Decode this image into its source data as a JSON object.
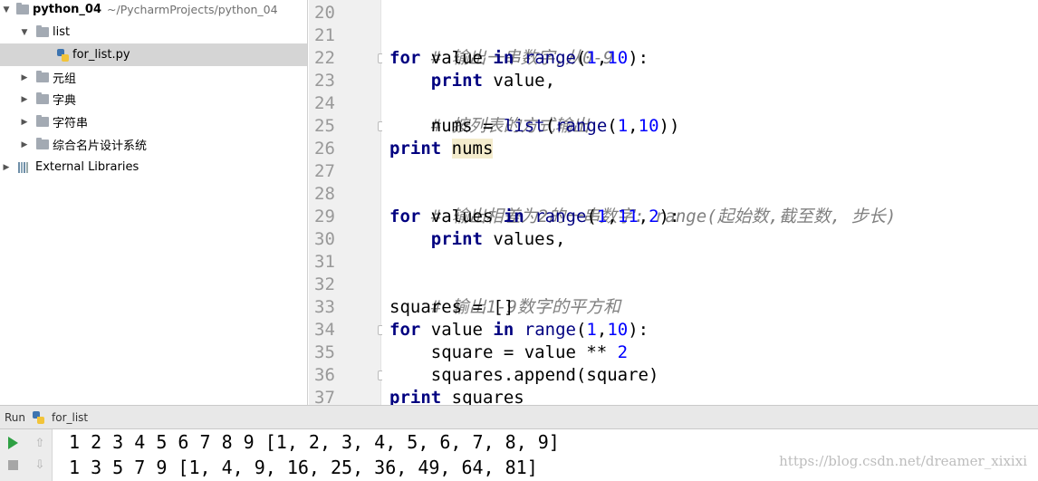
{
  "project_tree": {
    "project_name": "python_04",
    "project_path": "~/PycharmProjects/python_04",
    "items": [
      {
        "label": "list",
        "kind": "folder",
        "expanded": true
      },
      {
        "label": "for_list.py",
        "kind": "python-file",
        "selected": true
      },
      {
        "label": "元组",
        "kind": "folder"
      },
      {
        "label": "字典",
        "kind": "folder"
      },
      {
        "label": "字符串",
        "kind": "folder"
      },
      {
        "label": "综合名片设计系统",
        "kind": "folder"
      },
      {
        "label": "External Libraries",
        "kind": "library"
      }
    ]
  },
  "editor": {
    "line_numbers": [
      "20",
      "21",
      "22",
      "23",
      "24",
      "25",
      "26",
      "27",
      "28",
      "29",
      "30",
      "31",
      "32",
      "33",
      "34",
      "35",
      "36",
      "37"
    ],
    "lines": {
      "l21": {
        "comment": "# 输出一串数字,从0-9"
      },
      "l22": {
        "kw1": "for",
        "t1": " value ",
        "kw2": "in",
        "t2": " ",
        "fn": "range",
        "t3": "(",
        "n1": "1",
        "t4": ",",
        "n2": "10",
        "t5": "):"
      },
      "l23": {
        "indent": "    ",
        "kw": "print",
        "t1": " value,"
      },
      "l24": {
        "comment": "# 按列表的方式输出"
      },
      "l25": {
        "t0": "    nums = ",
        "fn1": "list",
        "t1": "(",
        "fn2": "range",
        "t2": "(",
        "n1": "1",
        "t3": ",",
        "n2": "10",
        "t4": "))"
      },
      "l26": {
        "kw": "print",
        "t1": " ",
        "hl": "nums"
      },
      "l28": {
        "comment": "# 输出相差为2的一串数字: range(起始数,截至数, 步长)"
      },
      "l29": {
        "kw1": "for",
        "t1": " values ",
        "kw2": "in",
        "t2": " ",
        "fn": "range",
        "t3": "(",
        "n1": "1",
        "t4": ",",
        "n2": "11",
        "t5": ",",
        "n3": "2",
        "t6": "):"
      },
      "l30": {
        "indent": "    ",
        "kw": "print",
        "t1": " values,"
      },
      "l32": {
        "comment": "# 输出1-9数字的平方和"
      },
      "l33": {
        "t0": "squares = []"
      },
      "l34": {
        "kw1": "for",
        "t1": " value ",
        "kw2": "in",
        "t2": " ",
        "fn": "range",
        "t3": "(",
        "n1": "1",
        "t4": ",",
        "n2": "10",
        "t5": "):"
      },
      "l35": {
        "t0": "    square = value ** ",
        "n1": "2"
      },
      "l36": {
        "t0": "    squares.append(square)"
      },
      "l37": {
        "kw": "print",
        "t1": " squares"
      }
    }
  },
  "run_panel": {
    "tab_label": "Run",
    "config_name": "for_list",
    "output": [
      "1 2 3 4 5 6 7 8 9 [1, 2, 3, 4, 5, 6, 7, 8, 9]",
      "1 3 5 7 9 [1, 4, 9, 16, 25, 36, 49, 64, 81]"
    ]
  },
  "watermark": "https://blog.csdn.net/dreamer_xixixi",
  "icons": {
    "run": "play-icon",
    "stop": "stop-icon",
    "up": "arrow-up-icon",
    "down": "arrow-down-icon",
    "python": "python-file-icon",
    "folder": "folder-icon"
  },
  "colors": {
    "keyword": "#000080",
    "number": "#0000ff",
    "comment": "#808080",
    "run_green": "#2ea043",
    "highlight": "#f4eccd",
    "selection": "#d5d5d5"
  }
}
